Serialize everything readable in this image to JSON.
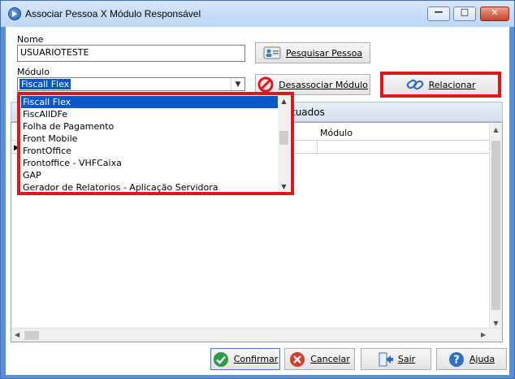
{
  "window": {
    "title": "Associar Pessoa X Módulo Responsável",
    "controls": {
      "minimize": "—",
      "maximize": "□",
      "close": "✕"
    }
  },
  "form": {
    "nome_label": "Nome",
    "nome_value": "USUARIOTESTE",
    "modulo_label": "Módulo",
    "modulo_value": "Fiscall Flex"
  },
  "buttons": {
    "pesquisar_pessoa": "Pesquisar Pessoa",
    "desassociar_modulo": "Desassociar Módulo",
    "relacionar": "Relacionar",
    "confirmar": "Confirmar",
    "cancelar": "Cancelar",
    "sair": "Sair",
    "ajuda": "Ajuda"
  },
  "tab": {
    "label": "tuados"
  },
  "grid": {
    "columns": [
      "Módulo"
    ]
  },
  "dropdown": {
    "items": [
      "Fiscall Flex",
      "FiscAllDFe",
      "Folha de Pagamento",
      "Front Mobile",
      "FrontOffice",
      "Frontoffice - VHFCaixa",
      "GAP",
      "Gerador de Relatorios - Aplicação Servidora"
    ],
    "selected_index": 0
  },
  "colors": {
    "highlight_red": "#e0161b",
    "selection_blue": "#0a58c7",
    "titlebar": "#d4e6fa"
  },
  "icons": {
    "app": "app-icon",
    "pesquisar": "person-card-icon",
    "desassociar": "no-entry-icon",
    "relacionar": "link-icon",
    "confirmar": "check-icon",
    "cancelar": "cancel-icon",
    "sair": "exit-door-icon",
    "ajuda": "help-icon"
  }
}
